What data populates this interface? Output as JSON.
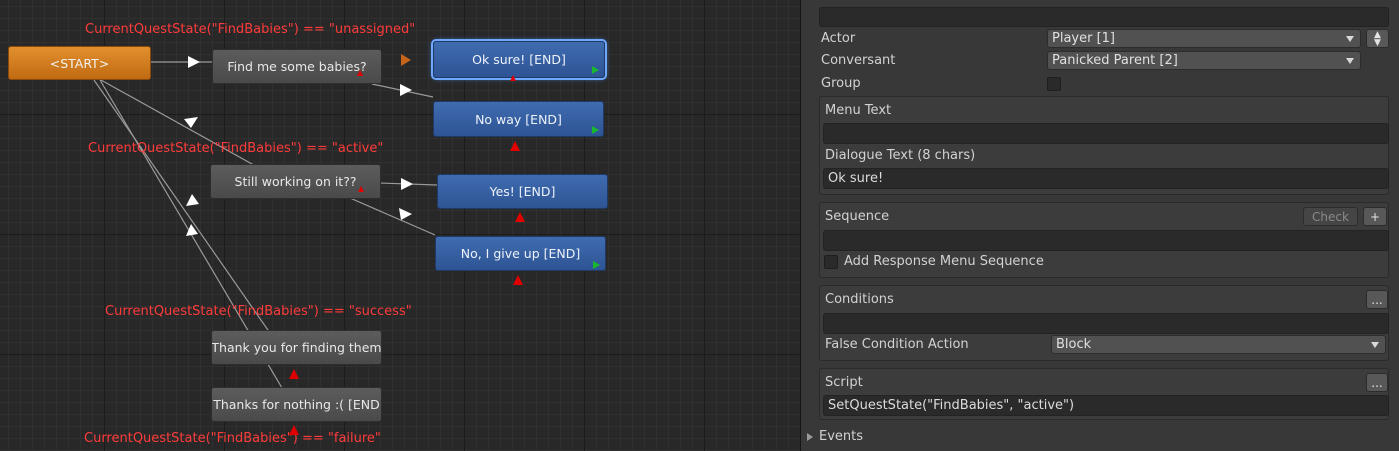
{
  "graph": {
    "nodes": {
      "start": "<START>",
      "find_babies": "Find me some babies?",
      "ok_sure": "Ok sure! [END]",
      "no_way": "No way [END]",
      "still_working": "Still working on it??",
      "yes": "Yes! [END]",
      "give_up": "No, I give up [END]",
      "thank_you": "Thank you for finding them",
      "thanks_nothing": "Thanks for nothing :( [END"
    },
    "conditions": {
      "unassigned": "CurrentQuestState(\"FindBabies\") == \"unassigned\"",
      "active": "CurrentQuestState(\"FindBabies\") == \"active\"",
      "success": "CurrentQuestState(\"FindBabies\") == \"success\"",
      "failure": "CurrentQuestState(\"FindBabies\") == \"failure\""
    },
    "colors": {
      "start_node": "#d57f20",
      "npc_node": "#525252",
      "pc_node": "#3762a4",
      "condition_text": "#ff3b3b",
      "link": "#9a9a9a"
    }
  },
  "inspector": {
    "actor_label": "Actor",
    "actor_value": "Player [1]",
    "conversant_label": "Conversant",
    "conversant_value": "Panicked Parent [2]",
    "group_label": "Group",
    "group_checked": false,
    "menu_text_label": "Menu Text",
    "menu_text_value": "",
    "dialogue_text_label": "Dialogue Text (8 chars)",
    "dialogue_text_value": "Ok sure!",
    "sequence_label": "Sequence",
    "check_button": "Check",
    "plus_button": "+",
    "sequence_value": "",
    "add_response_menu_sequence_label": "Add Response Menu Sequence",
    "add_response_menu_sequence_checked": false,
    "conditions_label": "Conditions",
    "conditions_button": "...",
    "conditions_value": "",
    "false_condition_action_label": "False Condition Action",
    "false_condition_action_value": "Block",
    "script_label": "Script",
    "script_button": "...",
    "script_value": "SetQuestState(\"FindBabies\", \"active\")",
    "events_label": "Events"
  }
}
